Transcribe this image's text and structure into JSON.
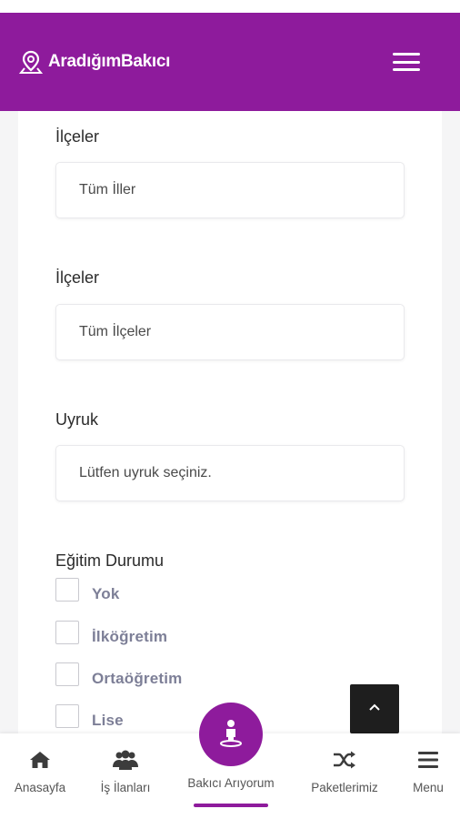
{
  "colors": {
    "brand": "#8e1b9c",
    "page_bg": "#f5f5f6",
    "check_label": "#7d7f97"
  },
  "header": {
    "brand_name": "AradığımBakıcı",
    "logo_icon": "map-pin-icon",
    "menu_icon": "hamburger-icon"
  },
  "form": {
    "fields": [
      {
        "label": "İlçeler",
        "value": "Tüm İller"
      },
      {
        "label": "İlçeler",
        "value": "Tüm İlçeler"
      },
      {
        "label": "Uyruk",
        "value": "Lütfen uyruk seçiniz."
      }
    ],
    "education": {
      "label": "Eğitim Durumu",
      "options": [
        "Yok",
        "İlköğretim",
        "Ortaöğretim",
        "Lise"
      ]
    }
  },
  "scroll_top_icon": "chevron-up-icon",
  "bottom_nav": {
    "items": [
      {
        "label": "Anasayfa",
        "icon": "home-icon"
      },
      {
        "label": "İş İlanları",
        "icon": "users-icon"
      },
      {
        "label": "Bakıcı Arıyorum",
        "icon": "caregiver-icon"
      },
      {
        "label": "Paketlerimiz",
        "icon": "shuffle-icon"
      },
      {
        "label": "Menu",
        "icon": "menu-icon"
      }
    ]
  }
}
